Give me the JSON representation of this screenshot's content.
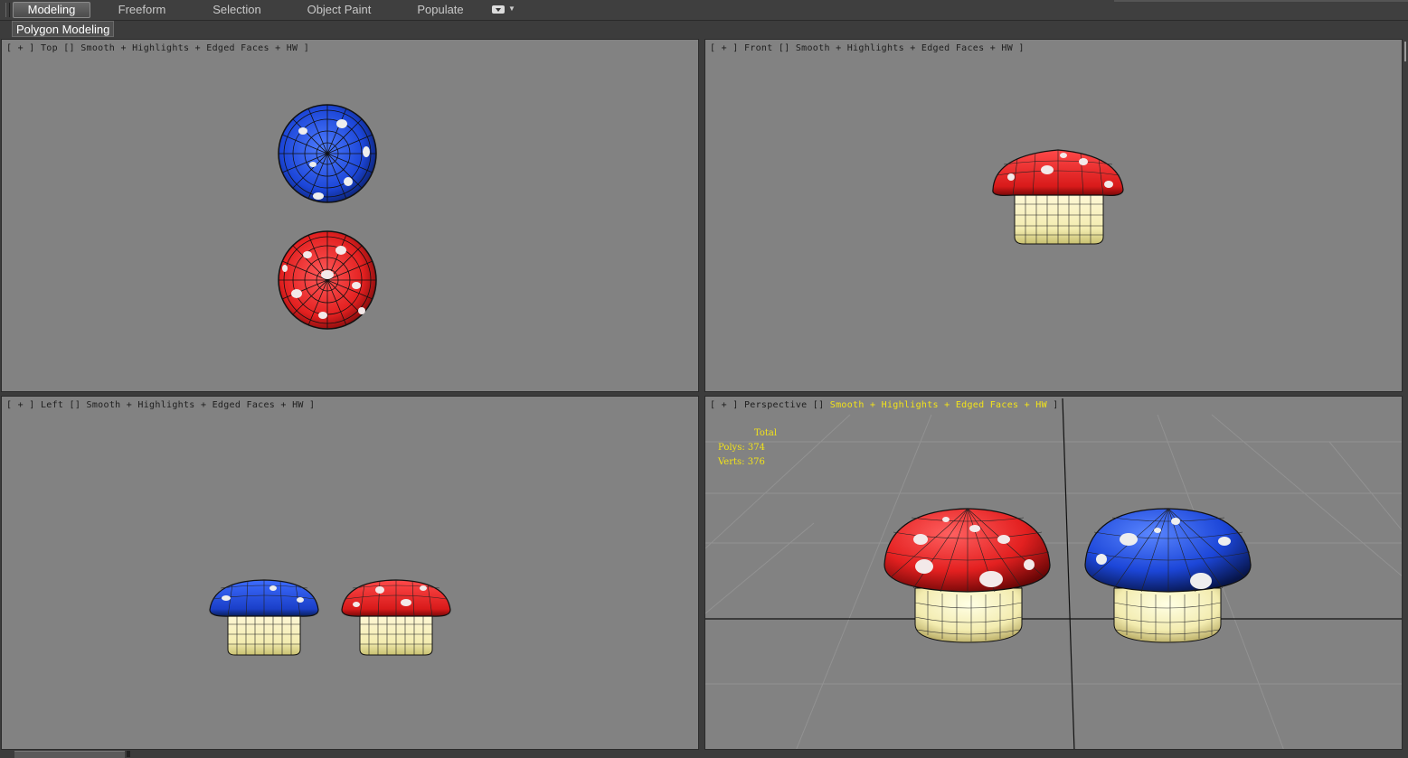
{
  "ribbon": {
    "tabs": [
      {
        "label": "Modeling",
        "active": true
      },
      {
        "label": "Freeform",
        "active": false
      },
      {
        "label": "Selection",
        "active": false
      },
      {
        "label": "Object Paint",
        "active": false
      },
      {
        "label": "Populate",
        "active": false
      }
    ],
    "panel_label": "Polygon Modeling"
  },
  "viewports": {
    "top": {
      "prefix": "[ + ] ",
      "view": "Top",
      "shading": "Smooth + Highlights + Edged Faces + HW",
      "suffix": " ]"
    },
    "front": {
      "prefix": "[ + ] ",
      "view": "Front",
      "shading": "Smooth + Highlights + Edged Faces + HW",
      "suffix": " ]"
    },
    "left": {
      "prefix": "[ + ] ",
      "view": "Left",
      "shading": "Smooth + Highlights + Edged Faces + HW",
      "suffix": " ]"
    },
    "perspective": {
      "prefix": "[ + ] ",
      "view": "Perspective",
      "shading": "Smooth + Highlights + Edged Faces + HW",
      "suffix": " ]"
    }
  },
  "stats": {
    "title": "Total",
    "polys_label": "Polys:",
    "polys": "374",
    "verts_label": "Verts:",
    "verts": "376"
  },
  "colors": {
    "viewport_bg": "#828282",
    "red_cap": "#e32020",
    "blue_cap": "#1c46d8",
    "stem": "#f3ecb0",
    "stats_text": "#f2e31a"
  },
  "icons": {
    "tab_menu": "dropdown-icon",
    "mushroom": "mushroom-model"
  }
}
